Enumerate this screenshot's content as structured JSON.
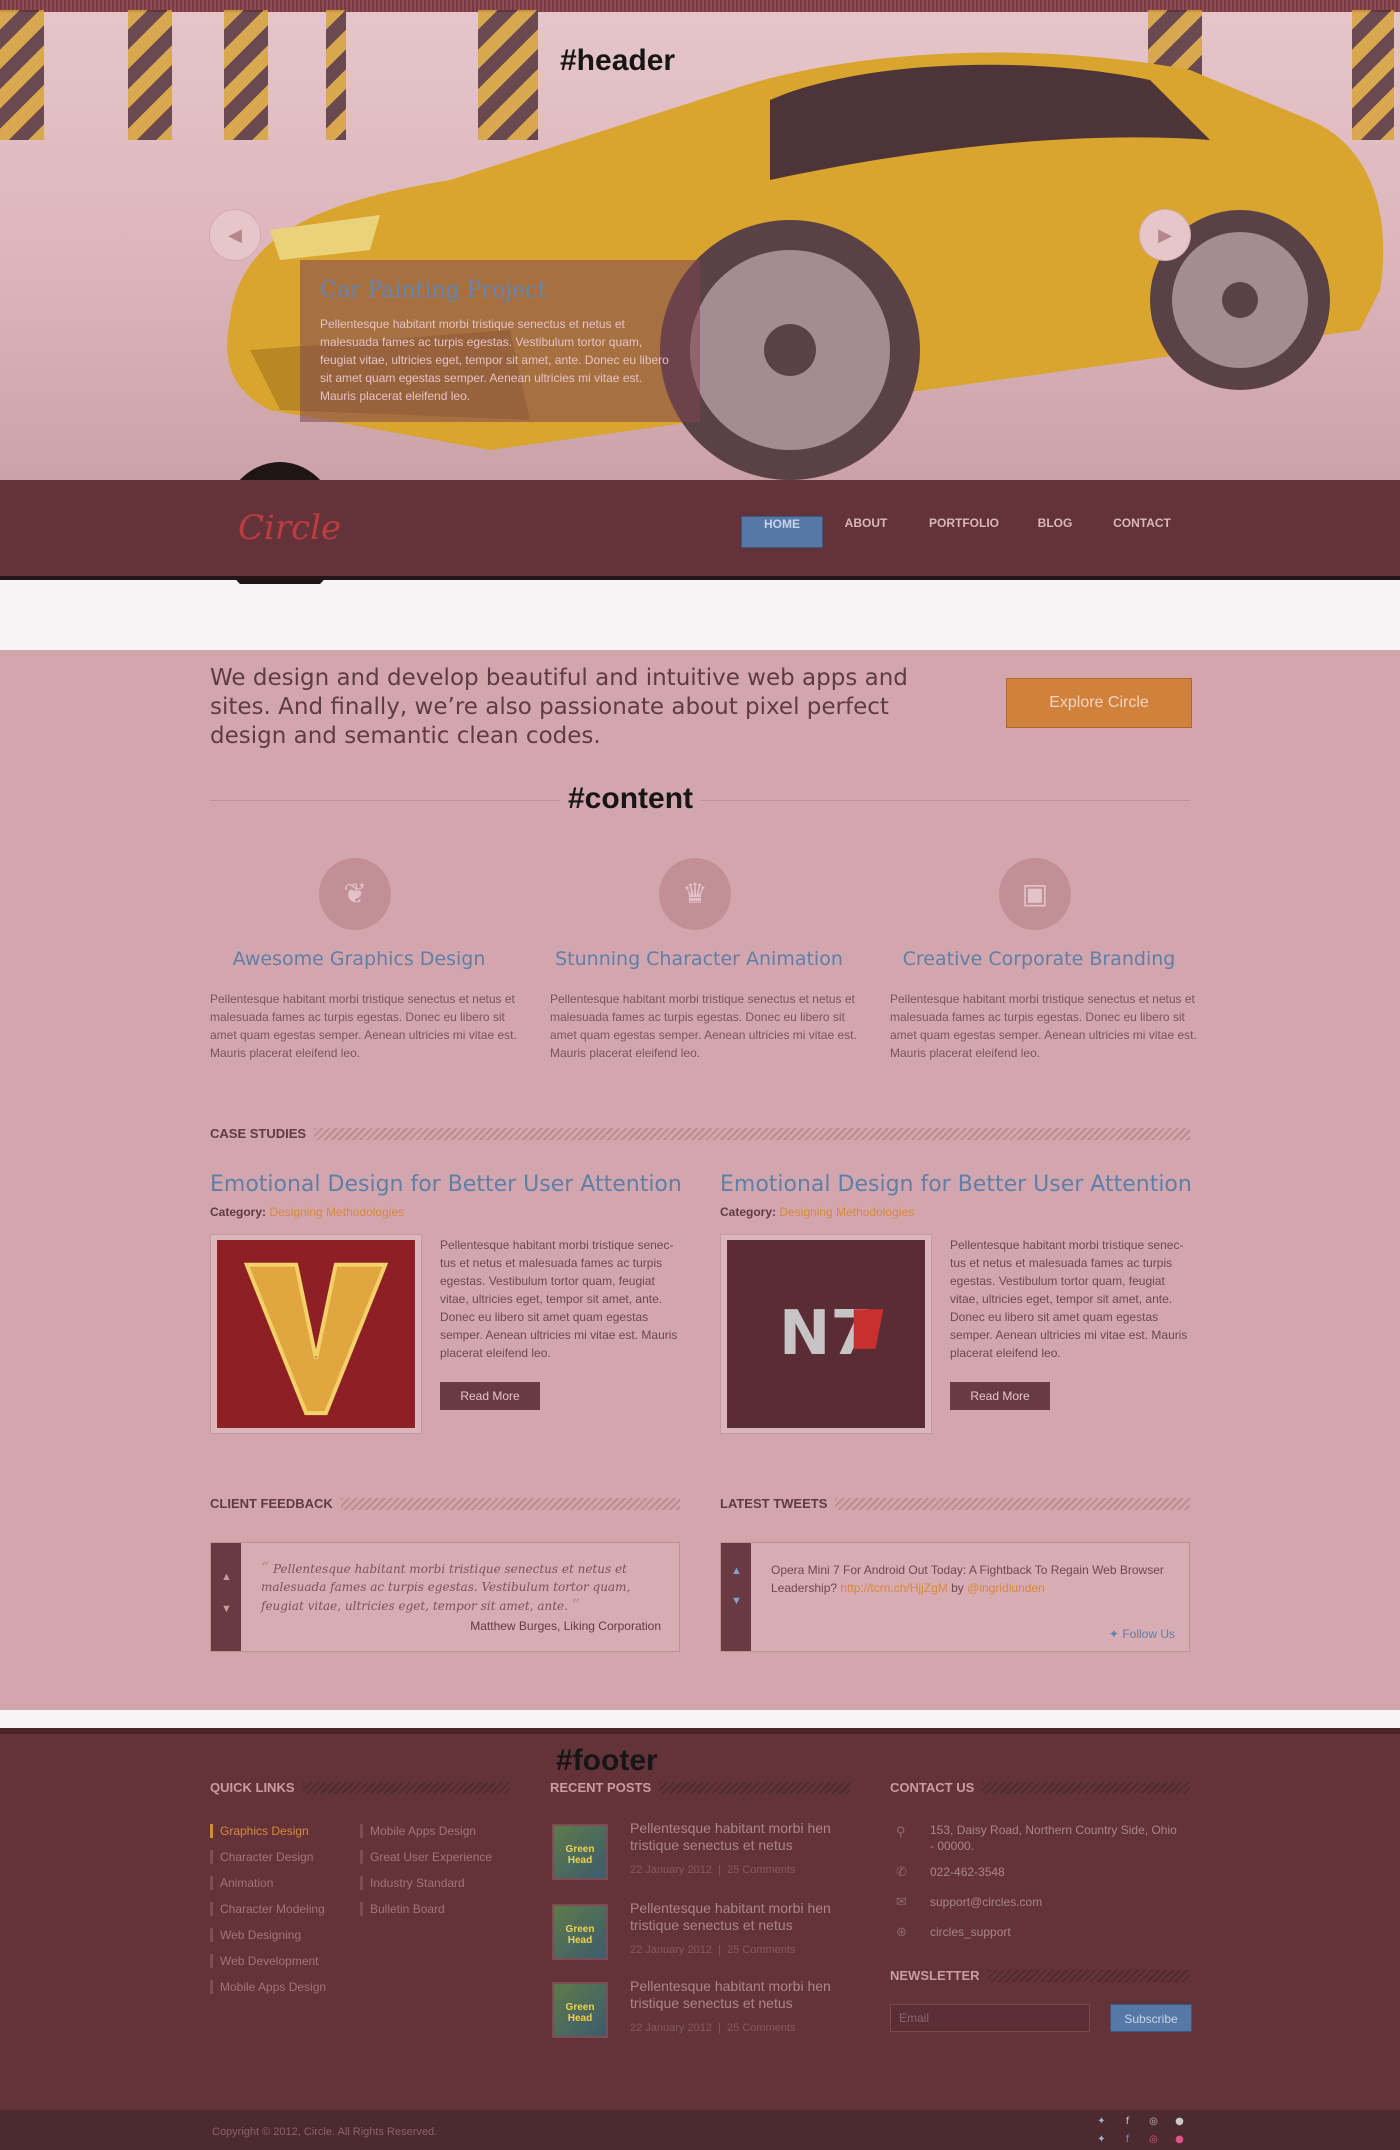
{
  "hero": {
    "label": "#header",
    "slide": {
      "title": "Car Painting Project",
      "text": "Pellentesque habitant morbi tristique senectus et netus et malesuada fames ac turpis egestas. Vestibulum tortor quam, feugiat vitae, ultricies eget, tempor sit amet, ante. Donec eu libero sit amet quam egestas semper. Aenean ultricies mi vitae est. Mauris placerat eleifend leo."
    },
    "prev_icon": "arrow-left-icon",
    "next_icon": "arrow-right-icon"
  },
  "nav": {
    "logo": "Circle",
    "items": [
      "HOME",
      "ABOUT",
      "PORTFOLIO",
      "BLOG",
      "CONTACT"
    ],
    "active": "HOME",
    "active_color": "#5678a6"
  },
  "content": {
    "label": "#content",
    "lead": "We design and develop beautiful and intuitive web apps and sites. And finally, we’re also passionate about pixel perfect design and semantic clean codes.",
    "cta": "Explore Circle",
    "features": [
      {
        "icon": "leaf-icon",
        "title": "Awesome Graphics Design",
        "text": "Pellentesque habitant morbi tristique senectus et netus et malesuada fames ac turpis egestas. Donec eu libero sit amet quam egestas semper. Aenean ultricies mi vitae est. Mauris placerat eleifend leo."
      },
      {
        "icon": "trophy-icon",
        "title": "Stunning Character Animation",
        "text": "Pellentesque habitant morbi tristique senectus et netus et malesuada fames ac turpis egestas. Donec eu libero sit amet quam egestas semper. Aenean ultricies mi vitae est. Mauris placerat eleifend leo."
      },
      {
        "icon": "briefcase-icon",
        "title": "Creative Corporate Branding",
        "text": "Pellentesque habitant morbi tristique senectus et netus et malesuada fames ac turpis egestas. Donec eu libero sit amet quam egestas semper. Aenean ultricies mi vitae est. Mauris placerat eleifend leo."
      }
    ],
    "case_studies": {
      "heading": "CASE STUDIES",
      "items": [
        {
          "title": "Emotional Design for Better User Attention",
          "category_label": "Category:",
          "category": "Designing Methodologies",
          "image_text": "V",
          "text": "Pellentesque habitant morbi tristique senec-tus et netus et malesuada fames ac turpis egestas. Vestibulum tortor quam, feugiat vitae, ultricies eget, tempor sit amet, ante. Donec eu libero sit amet quam egestas semper. Aenean ultricies mi vitae est. Mauris placerat eleifend leo.",
          "button": "Read More"
        },
        {
          "title": "Emotional Design for Better User Attention",
          "category_label": "Category:",
          "category": "Designing Methodologies",
          "image_text": "N7",
          "text": "Pellentesque habitant morbi tristique senec-tus et netus et malesuada fames ac turpis egestas. Vestibulum tortor quam, feugiat vitae, ultricies eget, tempor sit amet, ante. Donec eu libero sit amet quam egestas semper. Aenean ultricies mi vitae est. Mauris placerat eleifend leo.",
          "button": "Read More"
        }
      ]
    },
    "feedback": {
      "heading": "CLIENT FEEDBACK",
      "quote": "Pellentesque habitant morbi tristique senectus et netus et malesuada fames ac turpis egestas. Vestibulum tortor quam, feugiat vitae, ultricies eget, tempor sit amet, ante.",
      "author": "Matthew Burges, Liking Corporation"
    },
    "tweets": {
      "heading": "LATEST TWEETS",
      "text": "Opera Mini 7 For Android Out Today: A Fightback To Regain Web Browser Leadership?",
      "link": "http://tcrn.ch/HjjZgM",
      "by": "by",
      "handle": "@ingridlunden",
      "follow": "Follow Us"
    }
  },
  "footer": {
    "label": "#footer",
    "quick_links": {
      "heading": "QUICK LINKS",
      "col1": [
        "Graphics Design",
        "Character Design",
        "Animation",
        "Character Modeling",
        "Web Designing",
        "Web Development",
        "Mobile Apps Design"
      ],
      "col2": [
        "Mobile Apps Design",
        "Great User Experience",
        "Industry Standard",
        "Bulletin Board"
      ],
      "active": "Graphics Design"
    },
    "recent_posts": {
      "heading": "RECENT POSTS",
      "thumb_text": "Green Head",
      "items": [
        {
          "title": "Pellentesque habitant morbi hen tristique senectus et netus",
          "date": "22 January 2012",
          "comments": "25 Comments"
        },
        {
          "title": "Pellentesque habitant morbi hen tristique senectus et netus",
          "date": "22 January 2012",
          "comments": "25 Comments"
        },
        {
          "title": "Pellentesque habitant morbi hen tristique senectus et netus",
          "date": "22 January 2012",
          "comments": "25 Comments"
        }
      ]
    },
    "contact": {
      "heading": "CONTACT US",
      "address": "153, Daisy Road, Northern Country Side, Ohio - 00000.",
      "phone": "022-462-3548",
      "email": "support@circles.com",
      "skype": "circles_support"
    },
    "newsletter": {
      "heading": "NEWSLETTER",
      "placeholder": "Email",
      "button": "Subscribe"
    },
    "copyright": "Copyright © 2012, Circle. All Rights Reserved.",
    "social_icons": [
      "twitter-icon",
      "facebook-icon",
      "dribbble-icon",
      "flickr-icon"
    ]
  }
}
